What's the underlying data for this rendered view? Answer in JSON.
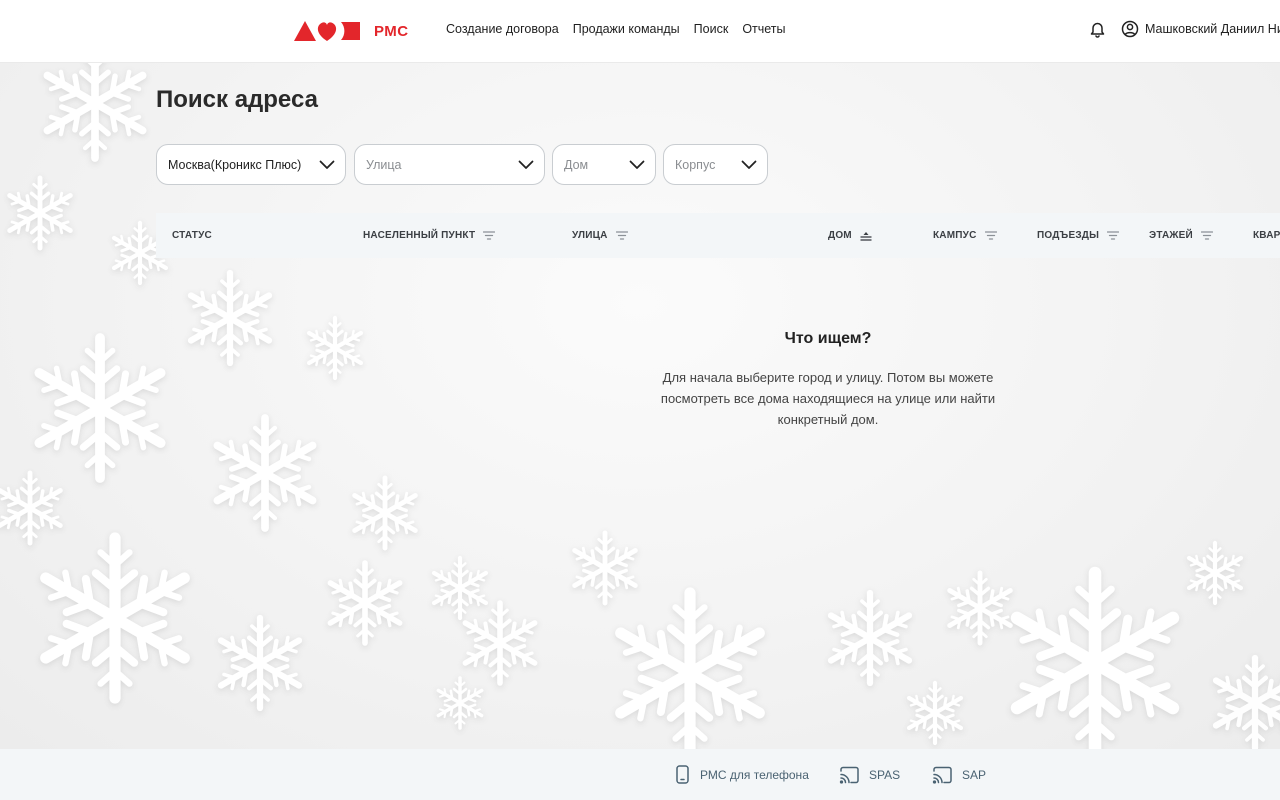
{
  "header": {
    "logo_text": "РМС",
    "brand_color": "#e3262b",
    "nav": [
      {
        "label": "Создание договора"
      },
      {
        "label": "Продажи команды"
      },
      {
        "label": "Поиск"
      },
      {
        "label": "Отчеты"
      }
    ],
    "user_name": "Машковский Даниил Ни"
  },
  "page": {
    "title": "Поиск адреса"
  },
  "filters": {
    "city": {
      "value": "Москва(Кроникс Плюс)"
    },
    "street": {
      "placeholder": "Улица"
    },
    "house": {
      "placeholder": "Дом"
    },
    "building": {
      "placeholder": "Корпус"
    }
  },
  "table": {
    "columns": [
      {
        "label": "СТАТУС",
        "sort": "none"
      },
      {
        "label": "НАСЕЛЕННЫЙ ПУНКТ",
        "sort": "filter"
      },
      {
        "label": "УЛИЦА",
        "sort": "filter"
      },
      {
        "label": "ДОМ",
        "sort": "asc"
      },
      {
        "label": "КАМПУС",
        "sort": "filter"
      },
      {
        "label": "ПОДЪЕЗДЫ",
        "sort": "filter"
      },
      {
        "label": "ЭТАЖЕЙ",
        "sort": "filter"
      },
      {
        "label": "КВАР",
        "sort": "none"
      }
    ]
  },
  "empty_state": {
    "title": "Что ищем?",
    "lines": [
      "Для начала выберите город и улицу. Потом вы можете",
      "посмотреть все дома находящиеся на улице или найти",
      "конкретный дом."
    ]
  },
  "footer": {
    "links": [
      {
        "label": "РМС для телефона",
        "icon": "phone-icon"
      },
      {
        "label": "SPAS",
        "icon": "cast-icon"
      },
      {
        "label": "SAP",
        "icon": "cast-icon"
      }
    ]
  }
}
